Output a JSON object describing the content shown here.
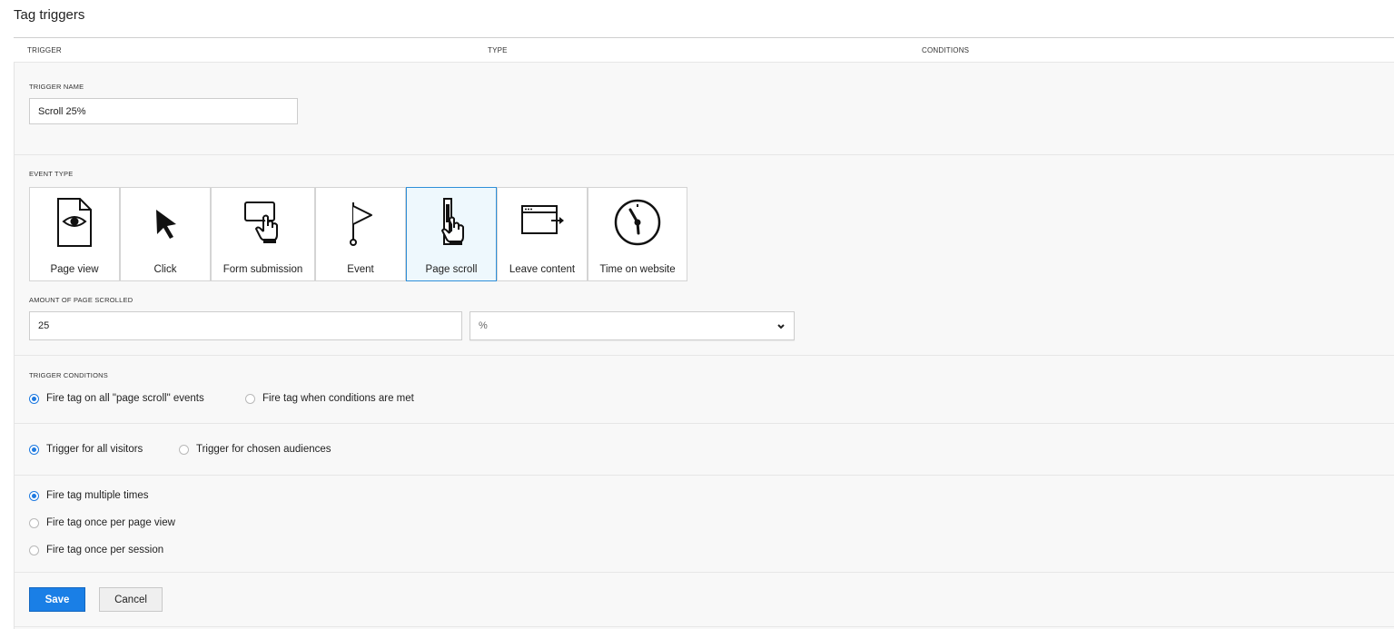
{
  "page": {
    "title": "Tag triggers"
  },
  "table": {
    "columns": [
      "TRIGGER",
      "TYPE",
      "CONDITIONS"
    ]
  },
  "trigger_name": {
    "label": "TRIGGER NAME",
    "value": "Scroll 25%"
  },
  "event_type": {
    "label": "EVENT TYPE",
    "options": [
      {
        "label": "Page view",
        "icon": "page-view-icon"
      },
      {
        "label": "Click",
        "icon": "cursor-icon"
      },
      {
        "label": "Form submission",
        "icon": "form-submission-icon"
      },
      {
        "label": "Event",
        "icon": "flag-icon"
      },
      {
        "label": "Page scroll",
        "icon": "page-scroll-icon"
      },
      {
        "label": "Leave content",
        "icon": "leave-content-icon"
      },
      {
        "label": "Time on website",
        "icon": "clock-icon"
      }
    ],
    "selected": "Page scroll"
  },
  "scroll_amount": {
    "label": "AMOUNT OF PAGE SCROLLED",
    "value": "25",
    "unit": "%"
  },
  "trigger_conditions": {
    "label": "TRIGGER CONDITIONS",
    "options": [
      "Fire tag on all \"page scroll\" events",
      "Fire tag when conditions are met"
    ],
    "selected": 0
  },
  "audience": {
    "options": [
      "Trigger for all visitors",
      "Trigger for chosen audiences"
    ],
    "selected": 0
  },
  "frequency": {
    "options": [
      "Fire tag multiple times",
      "Fire tag once per page view",
      "Fire tag once per session"
    ],
    "selected": 0
  },
  "actions": {
    "save": "Save",
    "cancel": "Cancel"
  },
  "colors": {
    "accent": "#1a7fe6",
    "selected_tile_border": "#2f8fd8",
    "selected_tile_bg": "#eef8fd"
  }
}
